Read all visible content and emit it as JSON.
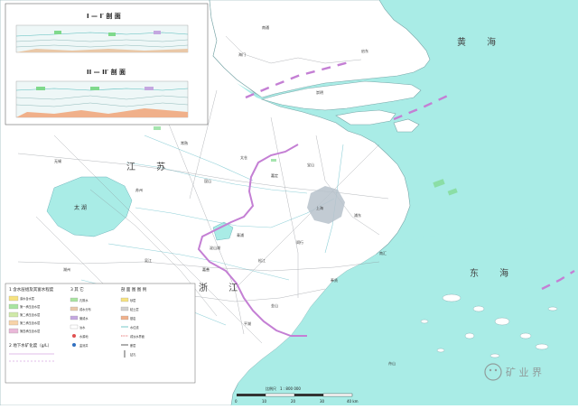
{
  "colors": {
    "sea": "#a9ece6",
    "land": "#ffffff",
    "boundary": "#c47fd4",
    "roads": "#8a8f96",
    "river": "#8fd0d8",
    "urban": "#b7c2cb"
  },
  "sections": {
    "section1_title": "I — I′ 剖 面",
    "section2_title": "II — II′ 剖 面"
  },
  "sea_labels": {
    "east_china_sea": "东 海",
    "yellow_sea": "黄 海"
  },
  "land_labels": {
    "jiangsu": "江 苏",
    "zhejiang": "浙 江",
    "taihu": "太 湖",
    "dianshan": "淀山湖"
  },
  "place_labels": {
    "chongming": "崇明",
    "haimen": "海门",
    "qidong": "启东",
    "nantong": "南通",
    "taicang": "太仓",
    "kunshan": "昆山",
    "suzhou": "苏州",
    "jiading": "嘉定",
    "baoshan": "宝山",
    "shanghai": "上海",
    "pudong": "浦东",
    "qingpu": "青浦",
    "songjiang": "松江",
    "minhang": "闵行",
    "fengxian": "奉贤",
    "jinshan": "金山",
    "pinghu": "平湖",
    "jiaxing": "嘉兴",
    "wujiang": "吴江",
    "huzhou": "湖州",
    "nanhui": "南汇",
    "zhoushan": "舟山",
    "changshu": "常熟",
    "wuxi": "无锡",
    "jiashan": "嘉善"
  },
  "legend": {
    "col1_title": "1  含水层组及其富水程度",
    "col1_items": [
      "潜水含水层",
      "第一承压含水层",
      "第二承压含水层",
      "第三承压含水层",
      "第四承压含水层"
    ],
    "col1_sub": "2  地下水矿化度（g/L）",
    "col2_title": "3  其 它",
    "col2_items": [
      "孔隙水",
      "咸水分布",
      "微咸水",
      "淡水",
      "水源地",
      "监测井"
    ],
    "col3_title": "剖 面 图 图 例",
    "col3_items": [
      "砂层",
      "粘土层",
      "基岩",
      "水位线",
      "咸淡水界面",
      "断层",
      "钻孔"
    ]
  },
  "scale": {
    "label": "比例尺　1 : 800 000",
    "ticks": [
      "0",
      "10",
      "20",
      "30",
      "40 km"
    ]
  },
  "watermark": "矿 业 界"
}
